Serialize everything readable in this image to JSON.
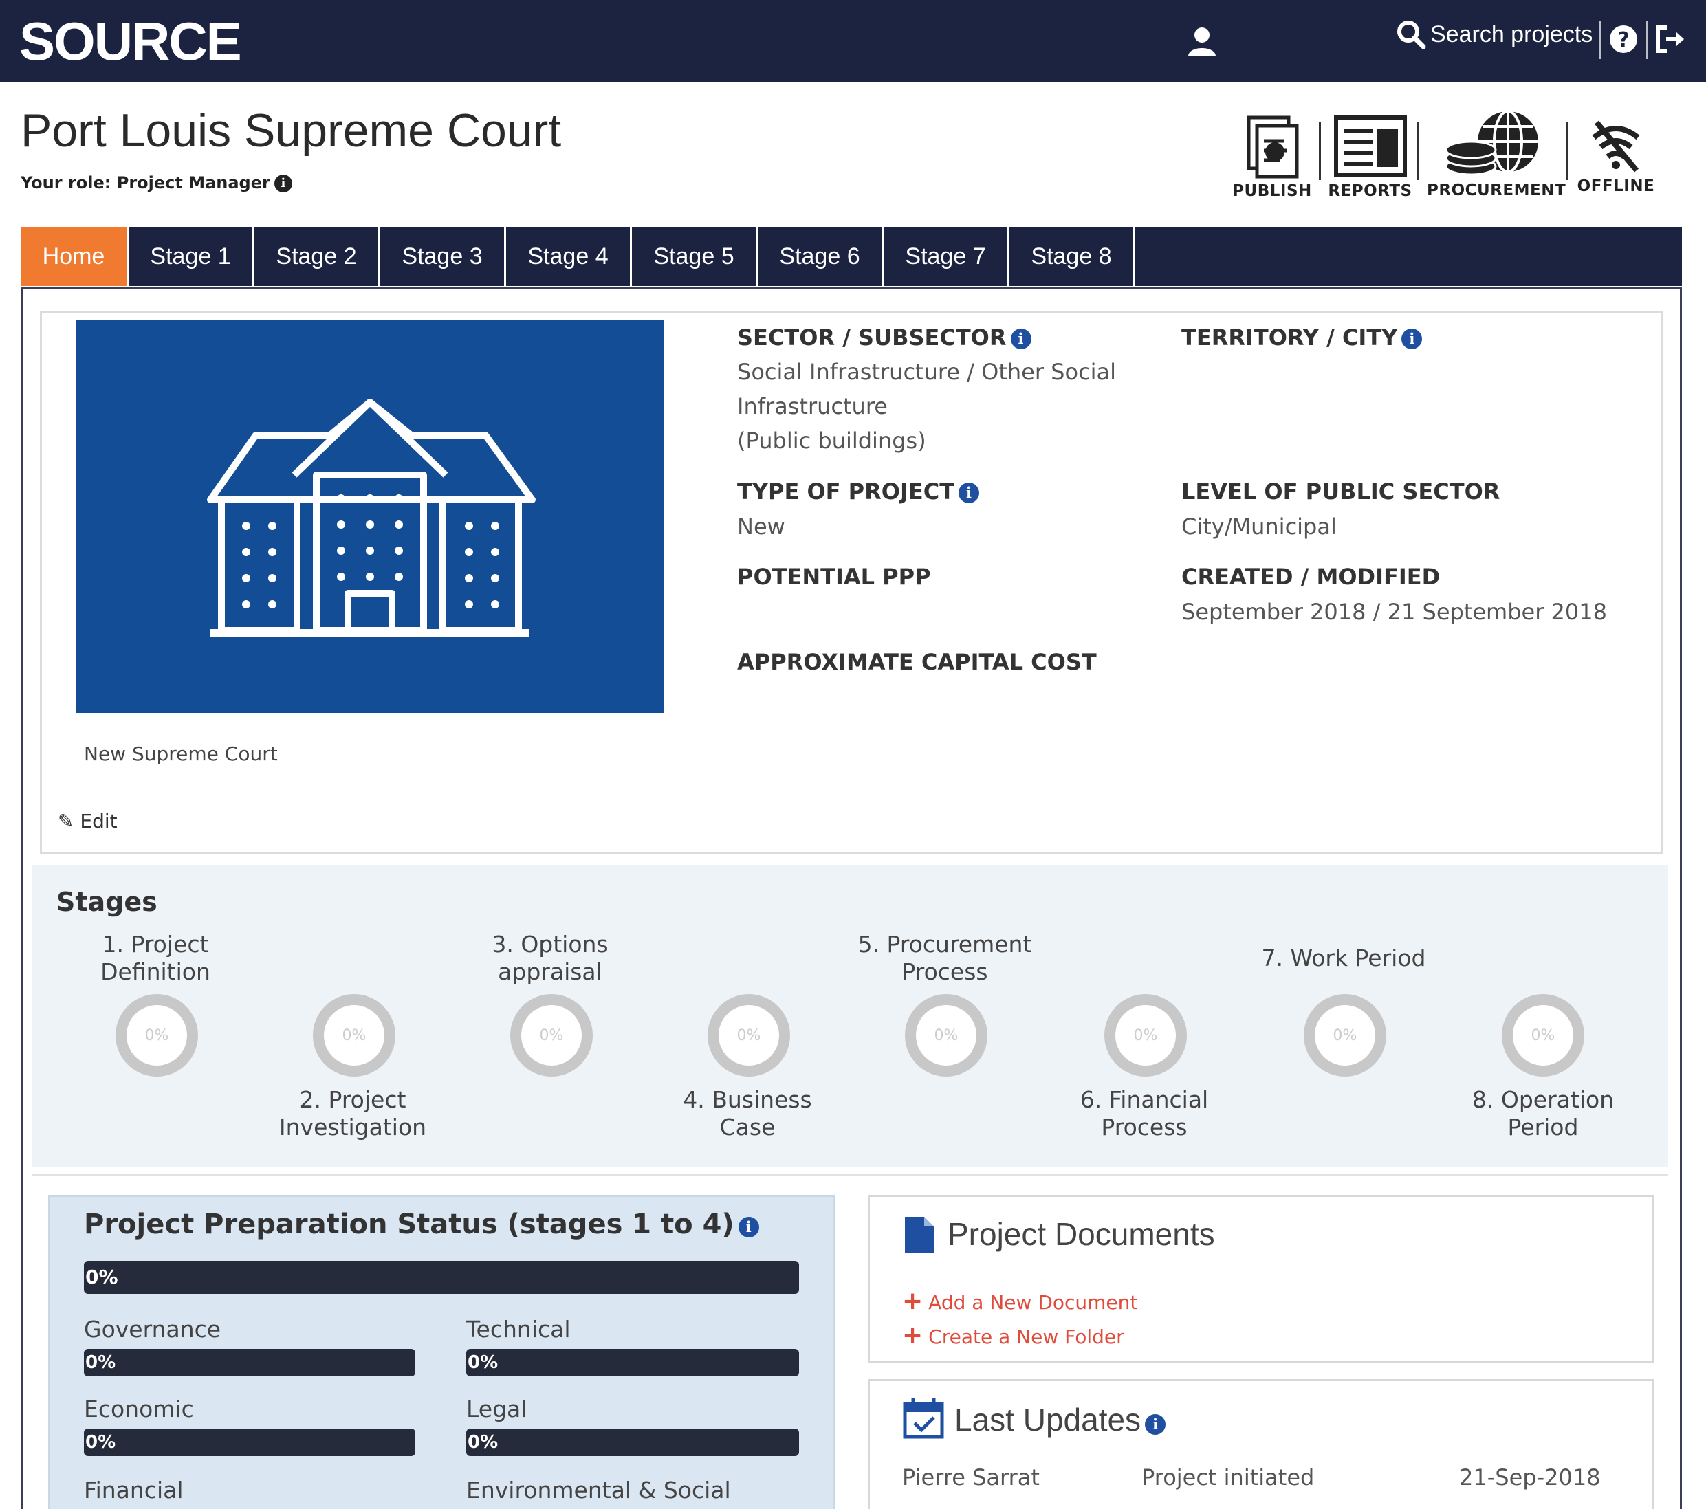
{
  "app": {
    "logo": "SOURCE",
    "search_label": "Search projects"
  },
  "colors": {
    "navy": "#1c2340",
    "accent_orange": "#f07a30",
    "image_blue": "#124d95",
    "link_red": "#e04c3b",
    "info_blue": "#1e4fa0"
  },
  "icons": {
    "user": "user-icon",
    "search": "search-icon",
    "help": "question-circle-icon",
    "logout": "logout-icon"
  },
  "header": {
    "title": "Port Louis Supreme Court",
    "role": "Your role: Project Manager"
  },
  "tools": [
    {
      "label": "PUBLISH",
      "icon": "publish-icon"
    },
    {
      "label": "REPORTS",
      "icon": "reports-icon"
    },
    {
      "label": "PROCUREMENT",
      "icon": "procurement-icon"
    },
    {
      "label": "OFFLINE",
      "icon": "wifi-off-icon"
    }
  ],
  "tabs": [
    "Home",
    "Stage 1",
    "Stage 2",
    "Stage 3",
    "Stage 4",
    "Stage 5",
    "Stage 6",
    "Stage 7",
    "Stage 8"
  ],
  "project": {
    "caption": "New Supreme Court",
    "edit_label": "Edit",
    "fields": {
      "sector_label": "SECTOR / SUBSECTOR",
      "sector_value_1": "Social Infrastructure / Other Social",
      "sector_value_2": "Infrastructure",
      "sector_value_3": "(Public buildings)",
      "territory_label": "TERRITORY / CITY",
      "type_label": "TYPE OF PROJECT",
      "type_value": "New",
      "level_label": "LEVEL OF PUBLIC SECTOR",
      "level_value": "City/Municipal",
      "ppp_label": "POTENTIAL PPP",
      "created_label": "CREATED / MODIFIED",
      "created_value": "September 2018 / 21 September 2018",
      "cost_label": "APPROXIMATE CAPITAL COST"
    }
  },
  "stages": {
    "title": "Stages",
    "items": [
      {
        "line1": "1. Project",
        "line2": "Definition",
        "percent": "0%"
      },
      {
        "line1": "2. Project",
        "line2": "Investigation",
        "percent": "0%"
      },
      {
        "line1": "3. Options",
        "line2": "appraisal",
        "percent": "0%"
      },
      {
        "line1": "4. Business",
        "line2": "Case",
        "percent": "0%"
      },
      {
        "line1": "5. Procurement",
        "line2": "Process",
        "percent": "0%"
      },
      {
        "line1": "6. Financial",
        "line2": "Process",
        "percent": "0%"
      },
      {
        "line1": "7. Work Period",
        "line2": "",
        "percent": "0%"
      },
      {
        "line1": "8. Operation",
        "line2": "Period",
        "percent": "0%"
      }
    ]
  },
  "prep": {
    "title": "Project Preparation Status (stages 1 to 4)",
    "overall": "0%",
    "items": [
      {
        "label": "Governance",
        "value": "0%"
      },
      {
        "label": "Technical",
        "value": "0%"
      },
      {
        "label": "Economic",
        "value": "0%"
      },
      {
        "label": "Legal",
        "value": "0%"
      },
      {
        "label": "Financial",
        "value": ""
      },
      {
        "label": "Environmental & Social",
        "value": ""
      }
    ]
  },
  "documents": {
    "title": "Project Documents",
    "add_label": "Add a New Document",
    "folder_label": "Create a New Folder"
  },
  "updates": {
    "title": "Last Updates",
    "rows": [
      {
        "user": "Pierre Sarrat",
        "action": "Project initiated",
        "date": "21-Sep-2018"
      }
    ]
  }
}
